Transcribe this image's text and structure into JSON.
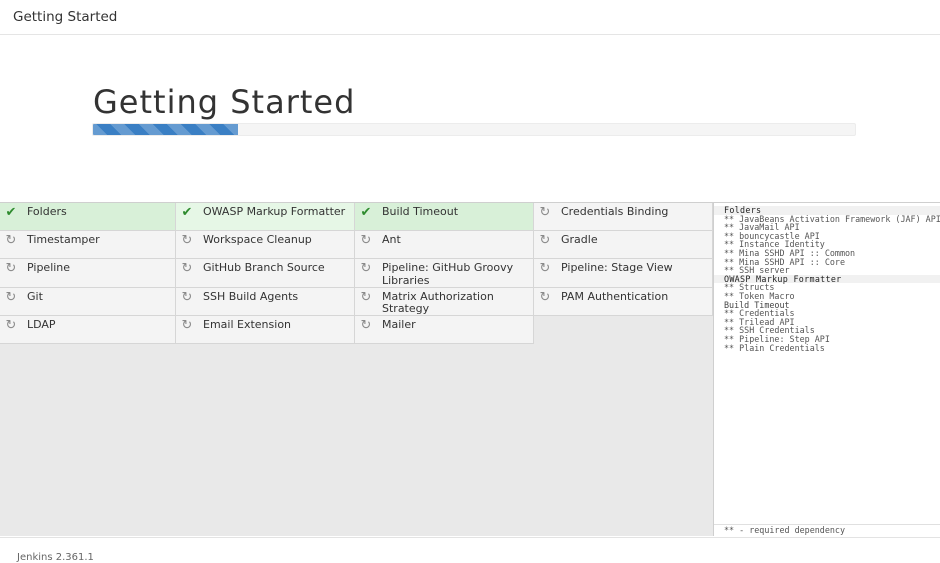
{
  "window": {
    "title": "Getting Started"
  },
  "hero": {
    "heading": "Getting Started",
    "progress_fraction": 0.19
  },
  "plugins": [
    {
      "name": "Folders",
      "status": "installed"
    },
    {
      "name": "OWASP Markup Formatter",
      "status": "installed"
    },
    {
      "name": "Build Timeout",
      "status": "installed"
    },
    {
      "name": "Credentials Binding",
      "status": "pending"
    },
    {
      "name": "Timestamper",
      "status": "pending"
    },
    {
      "name": "Workspace Cleanup",
      "status": "pending"
    },
    {
      "name": "Ant",
      "status": "pending"
    },
    {
      "name": "Gradle",
      "status": "pending"
    },
    {
      "name": "Pipeline",
      "status": "pending"
    },
    {
      "name": "GitHub Branch Source",
      "status": "pending"
    },
    {
      "name": "Pipeline: GitHub Groovy Libraries",
      "status": "pending"
    },
    {
      "name": "Pipeline: Stage View",
      "status": "pending"
    },
    {
      "name": "Git",
      "status": "pending"
    },
    {
      "name": "SSH Build Agents",
      "status": "pending"
    },
    {
      "name": "Matrix Authorization Strategy",
      "status": "pending"
    },
    {
      "name": "PAM Authentication",
      "status": "pending"
    },
    {
      "name": "LDAP",
      "status": "pending"
    },
    {
      "name": "Email Extension",
      "status": "pending"
    },
    {
      "name": "Mailer",
      "status": "pending"
    }
  ],
  "icons": {
    "installed": "check-icon",
    "pending": "refresh-icon"
  },
  "colors": {
    "installed_bg": "#d8f0d8",
    "progress": "#3a7fc4"
  },
  "install_log": [
    {
      "text": "Folders",
      "kind": "header"
    },
    {
      "text": "** JavaBeans Activation Framework (JAF) API",
      "kind": "dep"
    },
    {
      "text": "** JavaMail API",
      "kind": "dep"
    },
    {
      "text": "** bouncycastle API",
      "kind": "dep"
    },
    {
      "text": "** Instance Identity",
      "kind": "dep"
    },
    {
      "text": "** Mina SSHD API :: Common",
      "kind": "dep"
    },
    {
      "text": "** Mina SSHD API :: Core",
      "kind": "dep"
    },
    {
      "text": "** SSH server",
      "kind": "dep"
    },
    {
      "text": "OWASP Markup Formatter",
      "kind": "header"
    },
    {
      "text": "** Structs",
      "kind": "dep"
    },
    {
      "text": "** Token Macro",
      "kind": "dep"
    },
    {
      "text": "Build Timeout",
      "kind": "plain"
    },
    {
      "text": "** Credentials",
      "kind": "dep"
    },
    {
      "text": "** Trilead API",
      "kind": "dep"
    },
    {
      "text": "** SSH Credentials",
      "kind": "dep"
    },
    {
      "text": "** Pipeline: Step API",
      "kind": "dep"
    },
    {
      "text": "** Plain Credentials",
      "kind": "dep"
    }
  ],
  "log_legend": "** - required dependency",
  "footer": {
    "version": "Jenkins 2.361.1"
  }
}
